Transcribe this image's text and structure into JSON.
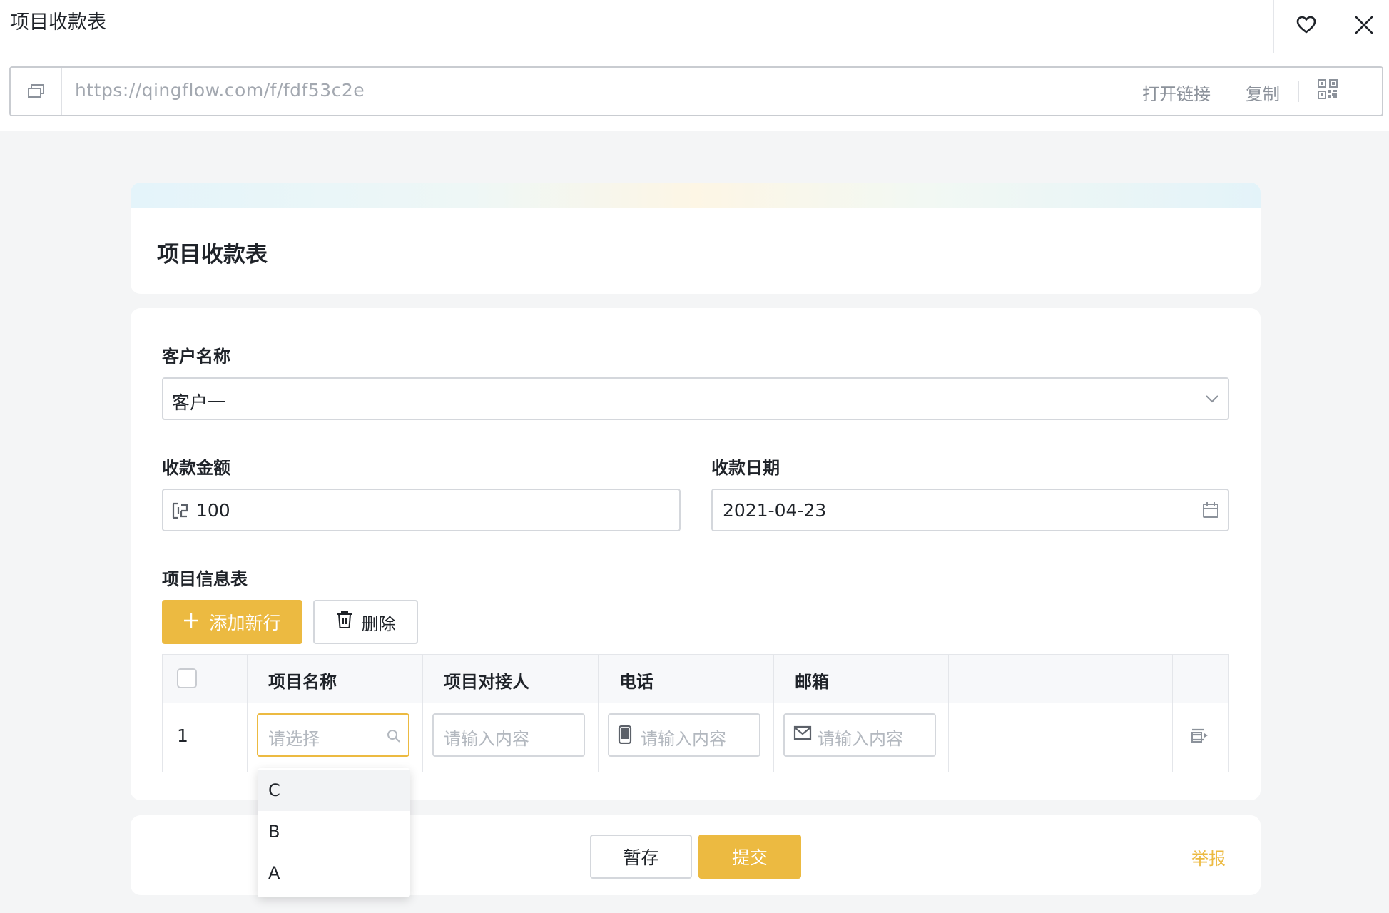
{
  "window": {
    "title": "项目收款表",
    "favorite_icon": "heart-outline-icon",
    "close_icon": "close-icon"
  },
  "link_bar": {
    "url": "https://qingflow.com/f/fdf53c2e",
    "open_label": "打开链接",
    "copy_label": "复制",
    "qr_icon": "qr-code-icon"
  },
  "form": {
    "title": "项目收款表",
    "customer": {
      "label": "客户名称",
      "value": "客户一"
    },
    "amount": {
      "label": "收款金额",
      "value": "100"
    },
    "date": {
      "label": "收款日期",
      "value": "2021-04-23"
    },
    "subtable": {
      "label": "项目信息表",
      "add_row_label": "添加新行",
      "delete_label": "删除",
      "columns": [
        "项目名称",
        "项目对接人",
        "电话",
        "邮箱"
      ],
      "rows": [
        {
          "index": "1",
          "project_name_placeholder": "请选择",
          "contact_placeholder": "请输入内容",
          "phone_placeholder": "请输入内容",
          "email_placeholder": "请输入内容"
        }
      ],
      "dropdown_options": [
        "C",
        "B",
        "A"
      ]
    }
  },
  "footer": {
    "save_label": "暂存",
    "submit_label": "提交",
    "report_label": "举报"
  },
  "colors": {
    "accent": "#ecba41",
    "border": "#d4d7dc",
    "background": "#f4f5f6"
  }
}
